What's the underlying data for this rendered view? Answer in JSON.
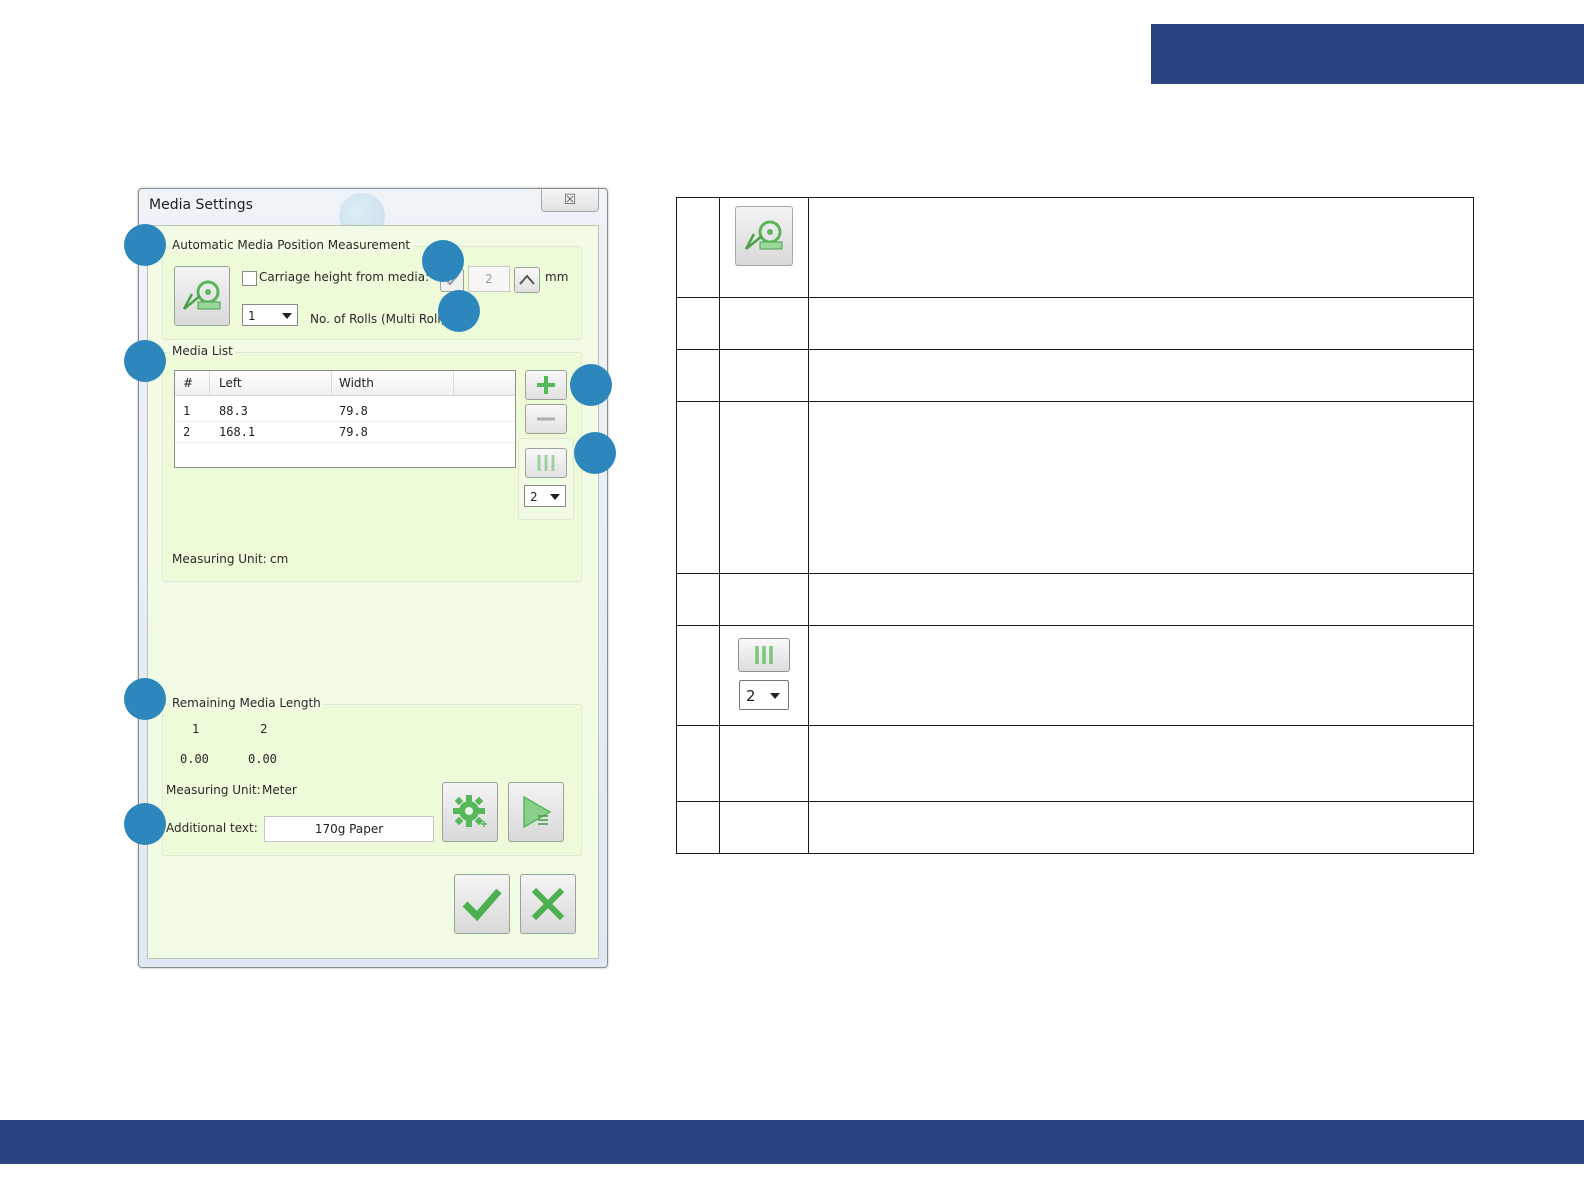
{
  "dialog": {
    "title": "Media Settings",
    "close_symbol": "☒"
  },
  "auto_measure": {
    "group_title": "Automatic Media Position Measurement",
    "measure_icon": "tape-measure-icon",
    "carriage_label": "Carriage height from media:",
    "carriage_checked": false,
    "height_value": "2",
    "unit": "mm",
    "rolls_value": "1",
    "rolls_label": "No. of Rolls (Multi Roll)"
  },
  "media_list": {
    "group_title": "Media List",
    "columns": [
      "#",
      "Left",
      "Width"
    ],
    "rows": [
      {
        "num": "1",
        "left": "88.3",
        "width": "79.8"
      },
      {
        "num": "2",
        "left": "168.1",
        "width": "79.8"
      }
    ],
    "split_count": "2",
    "measuring_unit_label": "Measuring Unit:",
    "measuring_unit_value": "cm"
  },
  "remaining": {
    "group_title": "Remaining Media Length",
    "headers": [
      "1",
      "2"
    ],
    "values": [
      "0.00",
      "0.00"
    ],
    "measuring_unit_label": "Measuring Unit:",
    "measuring_unit_value": "Meter",
    "additional_label": "Additional text:",
    "additional_value": "170g Paper"
  },
  "table": {
    "split_count": "2"
  },
  "colors": {
    "brand_bar": "#2b4284",
    "callout": "#2d87bd",
    "dialog_bg": "#f2fbe3",
    "icon_green": "#56b85a"
  }
}
